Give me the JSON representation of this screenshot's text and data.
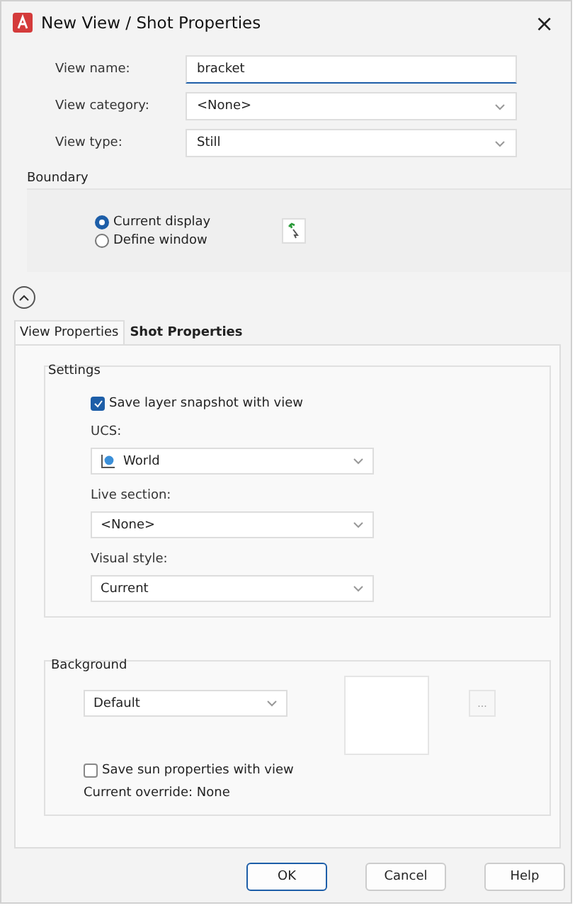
{
  "window": {
    "title": "New View / Shot Properties",
    "close": "×"
  },
  "fields": [
    {
      "kind": "text",
      "label": "View name:",
      "value": "bracket"
    },
    {
      "kind": "select",
      "label": "View category:",
      "value": "<None>"
    },
    {
      "kind": "select",
      "label": "View type:",
      "value": "Still"
    }
  ],
  "boundary": {
    "title": "Boundary",
    "options": [
      {
        "label": "Current display",
        "selected": true
      },
      {
        "label": "Define window",
        "selected": false
      }
    ]
  },
  "tabs": [
    {
      "label": "View Properties",
      "selected": true
    },
    {
      "label": "Shot Properties",
      "selected": false
    }
  ],
  "settings": {
    "title": "Settings",
    "snapshot": {
      "label": "Save layer snapshot with view",
      "checked": true
    },
    "dropdowns": [
      {
        "label": "UCS:",
        "value": "World",
        "icon": true
      },
      {
        "label": "Live section:",
        "value": "<None>",
        "icon": false
      },
      {
        "label": "Visual style:",
        "value": "Current",
        "icon": false
      }
    ]
  },
  "background": {
    "title": "Background",
    "value": "Default",
    "browse": "...",
    "sun": {
      "label": "Save sun properties with view",
      "checked": false
    },
    "override": "Current override: None"
  },
  "buttons": [
    {
      "label": "OK",
      "default": true
    },
    {
      "label": "Cancel",
      "default": false
    },
    {
      "label": "Help",
      "default": false
    }
  ]
}
